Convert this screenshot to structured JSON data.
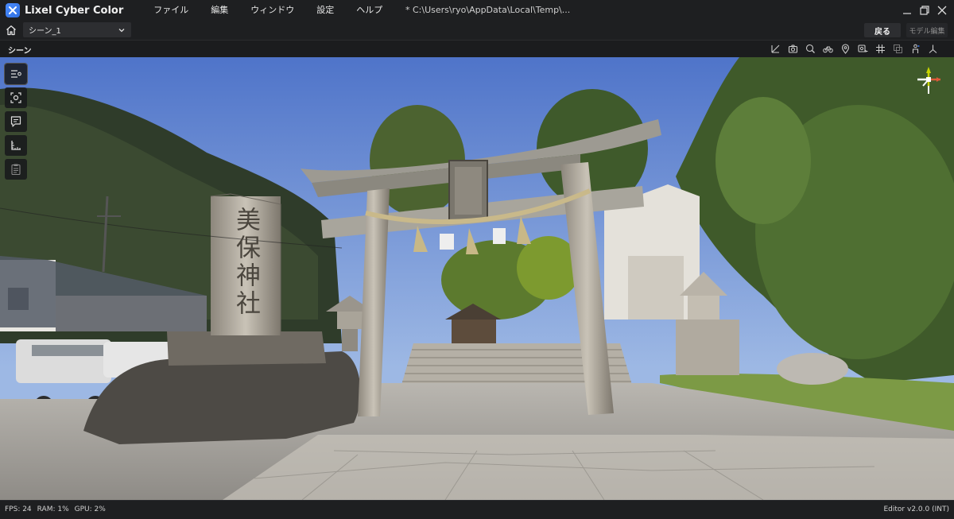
{
  "app": {
    "title": "Lixel Cyber Color",
    "file_path": "*  C:\\Users\\ryo\\AppData\\Local\\Temp\\..."
  },
  "menu": [
    "ファイル",
    "編集",
    "ウィンドウ",
    "設定",
    "ヘルプ"
  ],
  "toolbar": {
    "scene_selected": "シーン_1",
    "back_label": "戻る",
    "model_edit_label": "モデル編集"
  },
  "panel": {
    "title": "シーン",
    "tool_icons": [
      "measure-icon",
      "camera-icon",
      "paint-icon",
      "bicycle-icon",
      "pin-icon",
      "screenshot-8k-icon",
      "grid-icon",
      "layers-icon",
      "person-icon",
      "axes-icon"
    ]
  },
  "side_tools": [
    "scene-list-icon",
    "focus-icon",
    "notes-icon",
    "ruler-icon",
    "clipboard-icon"
  ],
  "scene": {
    "stone_pillar_text": "美保神社"
  },
  "status": {
    "fps": "FPS: 24",
    "ram": "RAM: 1%",
    "gpu": "GPU: 2%",
    "version": "Editor v2.0.0 (INT)"
  },
  "colors": {
    "accent": "#3d7bf0",
    "background": "#1b1c1e"
  }
}
